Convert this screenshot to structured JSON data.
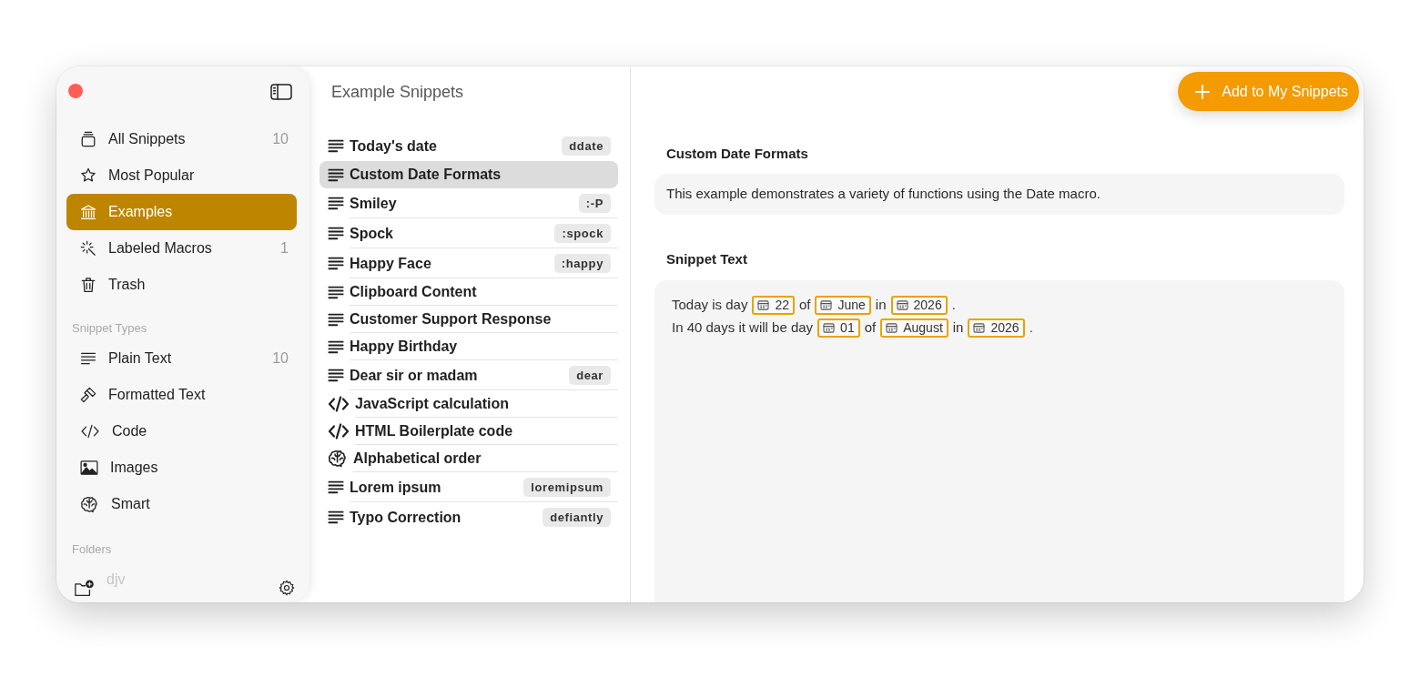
{
  "sidebar": {
    "library": [
      {
        "label": "All Snippets",
        "count": "10",
        "selected": false
      },
      {
        "label": "Most Popular",
        "selected": false
      },
      {
        "label": "Examples",
        "selected": true
      },
      {
        "label": "Labeled Macros",
        "count": "1",
        "selected": false
      },
      {
        "label": "Trash",
        "selected": false
      }
    ],
    "sections": [
      {
        "title": "Snippet Types",
        "items": [
          {
            "label": "Plain Text",
            "count": "10",
            "selected": false
          },
          {
            "label": "Formatted Text",
            "selected": false
          },
          {
            "label": "Code",
            "selected": false
          },
          {
            "label": "Images",
            "selected": false
          },
          {
            "label": "Smart",
            "selected": false
          }
        ]
      },
      {
        "title": "Folders",
        "items": [
          {
            "label": "djv",
            "selected": false
          }
        ]
      }
    ]
  },
  "snippet_list": {
    "title": "Example Snippets",
    "items": [
      {
        "title": "Today's date",
        "abbreviation": "ddate",
        "kind": "plain",
        "selected": false
      },
      {
        "title": "Custom Date Formats",
        "kind": "plain",
        "selected": true
      },
      {
        "title": "Smiley",
        "abbreviation": ":-P",
        "kind": "plain",
        "selected": false
      },
      {
        "title": "Spock",
        "abbreviation": ":spock",
        "kind": "plain",
        "selected": false
      },
      {
        "title": "Happy Face",
        "abbreviation": ":happy",
        "kind": "plain",
        "selected": false
      },
      {
        "title": "Clipboard Content",
        "kind": "plain",
        "selected": false
      },
      {
        "title": "Customer Support Response",
        "kind": "plain",
        "selected": false
      },
      {
        "title": "Happy Birthday",
        "kind": "plain",
        "selected": false
      },
      {
        "title": "Dear sir or madam",
        "abbreviation": "dear",
        "kind": "plain",
        "selected": false
      },
      {
        "title": "JavaScript calculation",
        "kind": "code",
        "selected": false
      },
      {
        "title": "HTML Boilerplate code",
        "kind": "code",
        "selected": false
      },
      {
        "title": "Alphabetical order",
        "kind": "smart",
        "selected": false
      },
      {
        "title": "Lorem ipsum",
        "abbreviation": "loremipsum",
        "kind": "plain",
        "selected": false
      },
      {
        "title": "Typo Correction",
        "abbreviation": "defiantly",
        "kind": "plain",
        "selected": false
      }
    ]
  },
  "detail": {
    "action_button": "Add to My Snippets",
    "title": "Custom Date Formats",
    "description": "This example demonstrates a variety of functions using the Date macro.",
    "snippet_label": "Snippet Text",
    "snippet_lines": [
      [
        {
          "kind": "text",
          "text": "Today is day"
        },
        {
          "kind": "date_field",
          "text": "22"
        },
        {
          "kind": "text",
          "text": "of"
        },
        {
          "kind": "date_field",
          "text": "June"
        },
        {
          "kind": "text",
          "text": "in"
        },
        {
          "kind": "date_field",
          "text": "2026"
        },
        {
          "kind": "text",
          "text": "."
        }
      ],
      [
        {
          "kind": "text",
          "text": "In 40 days it will be day"
        },
        {
          "kind": "date_field",
          "text": "01"
        },
        {
          "kind": "text",
          "text": "of"
        },
        {
          "kind": "date_field",
          "text": "August"
        },
        {
          "kind": "text",
          "text": "in"
        },
        {
          "kind": "date_field",
          "text": "2026"
        },
        {
          "kind": "text",
          "text": "."
        }
      ]
    ]
  }
}
